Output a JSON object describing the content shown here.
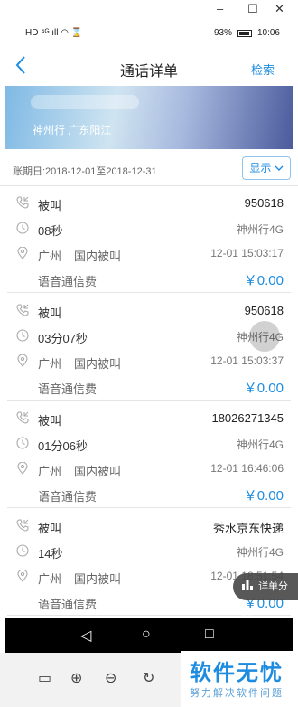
{
  "window": {
    "minimize": "–",
    "maximize": "☐",
    "close": "✕"
  },
  "status_bar": {
    "left_icons": "HD ⁴ᴳ ıll ◠ ⌛",
    "battery": "93%",
    "time": "10:06"
  },
  "nav": {
    "title": "通话详单",
    "search": "检索",
    "back_icon": "chevron-left-icon"
  },
  "banner": {
    "text": "神州行   广东阳江"
  },
  "period": {
    "text": "账期日:2018-12-01至2018-12-31",
    "show_button": "显示"
  },
  "records": [
    {
      "type": "被叫",
      "number": "950618",
      "duration": "08秒",
      "plan": "神州行4G",
      "location": "广州",
      "call_kind": "国内被叫",
      "datetime": "12-01 15:03:17",
      "fee_label": "语音通信费",
      "fee": "￥0.00"
    },
    {
      "type": "被叫",
      "number": "950618",
      "duration": "03分07秒",
      "plan": "神州行4G",
      "location": "广州",
      "call_kind": "国内被叫",
      "datetime": "12-01 15:03:37",
      "fee_label": "语音通信费",
      "fee": "￥0.00"
    },
    {
      "type": "被叫",
      "number": "18026271345",
      "duration": "01分06秒",
      "plan": "神州行4G",
      "location": "广州",
      "call_kind": "国内被叫",
      "datetime": "12-01 16:46:06",
      "fee_label": "语音通信费",
      "fee": "￥0.00"
    },
    {
      "type": "被叫",
      "number": "秀水京东快递",
      "duration": "14秒",
      "plan": "神州行4G",
      "location": "广州",
      "call_kind": "国内被叫",
      "datetime": "12-01 18:51:54",
      "fee_label": "语音通信费",
      "fee": "￥0.00"
    }
  ],
  "float_button": {
    "label": "详单分析"
  },
  "android_nav": {
    "back": "◁",
    "home": "○",
    "recents": "□"
  },
  "toolbar": {
    "layout": "▭",
    "zoom_in": "⊕",
    "zoom_out": "⊖",
    "rotate": "↻"
  },
  "watermark": {
    "main": "软件无忧",
    "sub": "努力解决软件问题"
  }
}
